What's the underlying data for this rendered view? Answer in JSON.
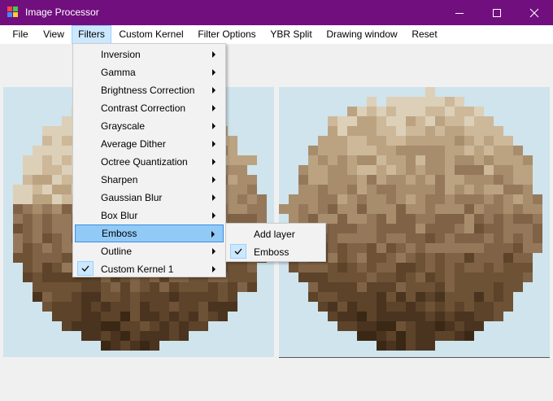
{
  "window": {
    "title": "Image Processor"
  },
  "title_buttons": [
    "minimize-icon",
    "maximize-icon",
    "close-icon"
  ],
  "menubar": [
    "File",
    "View",
    "Filters",
    "Custom Kernel",
    "Filter Options",
    "YBR Split",
    "Drawing window",
    "Reset"
  ],
  "filters_menu": {
    "items": [
      {
        "label": "Inversion",
        "submenu": true,
        "checked": false
      },
      {
        "label": "Gamma",
        "submenu": true,
        "checked": false
      },
      {
        "label": "Brightness Correction",
        "submenu": true,
        "checked": false
      },
      {
        "label": "Contrast Correction",
        "submenu": true,
        "checked": false
      },
      {
        "label": "Grayscale",
        "submenu": true,
        "checked": false
      },
      {
        "label": "Average Dither",
        "submenu": true,
        "checked": false
      },
      {
        "label": "Octree Quantization",
        "submenu": true,
        "checked": false
      },
      {
        "label": "Sharpen",
        "submenu": true,
        "checked": false
      },
      {
        "label": "Gaussian Blur",
        "submenu": true,
        "checked": false
      },
      {
        "label": "Box Blur",
        "submenu": true,
        "checked": false
      },
      {
        "label": "Emboss",
        "submenu": true,
        "checked": false,
        "highlighted": true
      },
      {
        "label": "Outline",
        "submenu": true,
        "checked": false
      },
      {
        "label": "Custom Kernel 1",
        "submenu": true,
        "checked": true
      }
    ]
  },
  "emboss_submenu": {
    "items": [
      {
        "label": "Add layer",
        "checked": false
      },
      {
        "label": "Emboss",
        "checked": true
      }
    ]
  },
  "colors": {
    "titlebar": "#710f7f",
    "highlight": "#91c9f7",
    "panel_bg": "#cfe4ec",
    "image_palette": [
      "#3a2815",
      "#4a3420",
      "#5c4329",
      "#6e5236",
      "#806346",
      "#95785a",
      "#a88d6d",
      "#bba382",
      "#cdb89a",
      "#ddd0b8"
    ]
  }
}
